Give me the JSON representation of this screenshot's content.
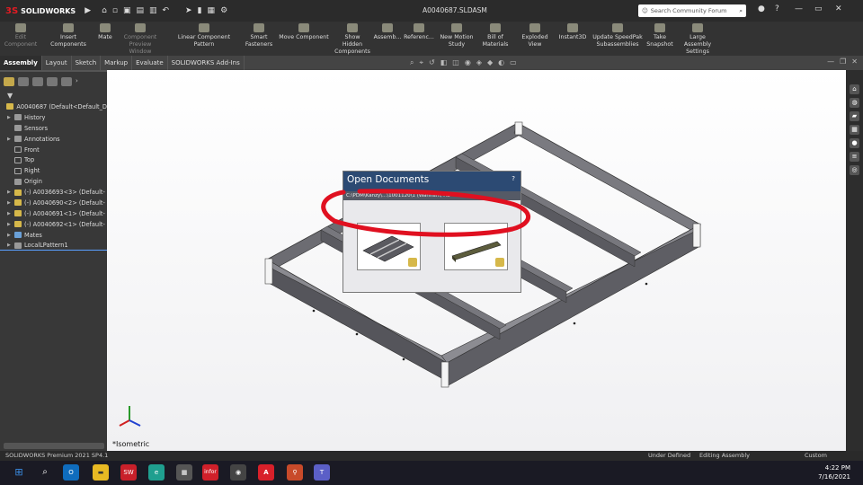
{
  "titlebar": {
    "app_name": "SOLIDWORKS",
    "document_title": "A0040687.SLDASM",
    "search_placeholder": "Search Community Forum"
  },
  "commands": [
    {
      "label": "Edit Component",
      "enabled": false
    },
    {
      "label": "Insert Components",
      "enabled": true
    },
    {
      "label": "Mate",
      "enabled": true
    },
    {
      "label": "Component Preview Window",
      "enabled": false
    },
    {
      "label": "Linear Component Pattern",
      "enabled": true
    },
    {
      "label": "Smart Fasteners",
      "enabled": true
    },
    {
      "label": "Move Component",
      "enabled": true
    },
    {
      "label": "Show Hidden Components",
      "enabled": true
    },
    {
      "label": "Assemb...",
      "enabled": true
    },
    {
      "label": "Referenc...",
      "enabled": true
    },
    {
      "label": "New Motion Study",
      "enabled": true
    },
    {
      "label": "Bill of Materials",
      "enabled": true
    },
    {
      "label": "Exploded View",
      "enabled": true
    },
    {
      "label": "Instant3D",
      "enabled": true
    },
    {
      "label": "Update SpeedPak Subassemblies",
      "enabled": true
    },
    {
      "label": "Take Snapshot",
      "enabled": true
    },
    {
      "label": "Large Assembly Settings",
      "enabled": true
    }
  ],
  "tabs": [
    "Assembly",
    "Layout",
    "Sketch",
    "Markup",
    "Evaluate",
    "SOLIDWORKS Add-Ins"
  ],
  "active_tab": "Assembly",
  "tree": {
    "nodes": [
      {
        "label": "A0040687  (Default<Default_D",
        "icon": "part",
        "arrow": false,
        "indent": 0
      },
      {
        "label": "History",
        "icon": "folder",
        "arrow": true,
        "indent": 1
      },
      {
        "label": "Sensors",
        "icon": "folder",
        "arrow": false,
        "indent": 1
      },
      {
        "label": "Annotations",
        "icon": "folder",
        "arrow": true,
        "indent": 1
      },
      {
        "label": "Front",
        "icon": "plane",
        "arrow": false,
        "indent": 1
      },
      {
        "label": "Top",
        "icon": "plane",
        "arrow": false,
        "indent": 1
      },
      {
        "label": "Right",
        "icon": "plane",
        "arrow": false,
        "indent": 1
      },
      {
        "label": "Origin",
        "icon": "origin",
        "arrow": false,
        "indent": 1
      },
      {
        "label": "(-) A0036693<3> (Default-",
        "icon": "part",
        "arrow": true,
        "indent": 1
      },
      {
        "label": "(-) A0040690<2> (Default-",
        "icon": "part",
        "arrow": true,
        "indent": 1
      },
      {
        "label": "(-) A0040691<1> (Default-",
        "icon": "part",
        "arrow": true,
        "indent": 1
      },
      {
        "label": "(-) A0040692<1> (Default-",
        "icon": "part",
        "arrow": true,
        "indent": 1
      },
      {
        "label": "Mates",
        "icon": "mates",
        "arrow": true,
        "indent": 1
      },
      {
        "label": "LocalLPattern1",
        "icon": "pattern",
        "arrow": true,
        "indent": 1
      }
    ]
  },
  "viewport": {
    "view_label": "*Isometric"
  },
  "popup": {
    "title": "Open Documents",
    "help": "?",
    "path": "C:\\PDM\\Kanzy\\...\\1001120\\1 (Wanham, AB - N..."
  },
  "statusbar": {
    "product": "SOLIDWORKS Premium 2021 SP4.1",
    "definition": "Under Defined",
    "mode": "Editing Assembly",
    "units": "Custom"
  },
  "taskbar": {
    "apps": [
      "windows-start",
      "search",
      "outlook",
      "file-explorer",
      "solidworks",
      "edge",
      "calculator",
      "infor",
      "camera",
      "acrobat",
      "solidworks-pdm",
      "teams"
    ],
    "app_badges": {
      "solidworks": "SW",
      "infor": "infor"
    },
    "time": "4:22 PM",
    "date": "7/16/2021"
  },
  "colors": {
    "popup_header": "#2c4a73",
    "annotation": "#e01020",
    "frame_steel": "#6c6c72"
  }
}
